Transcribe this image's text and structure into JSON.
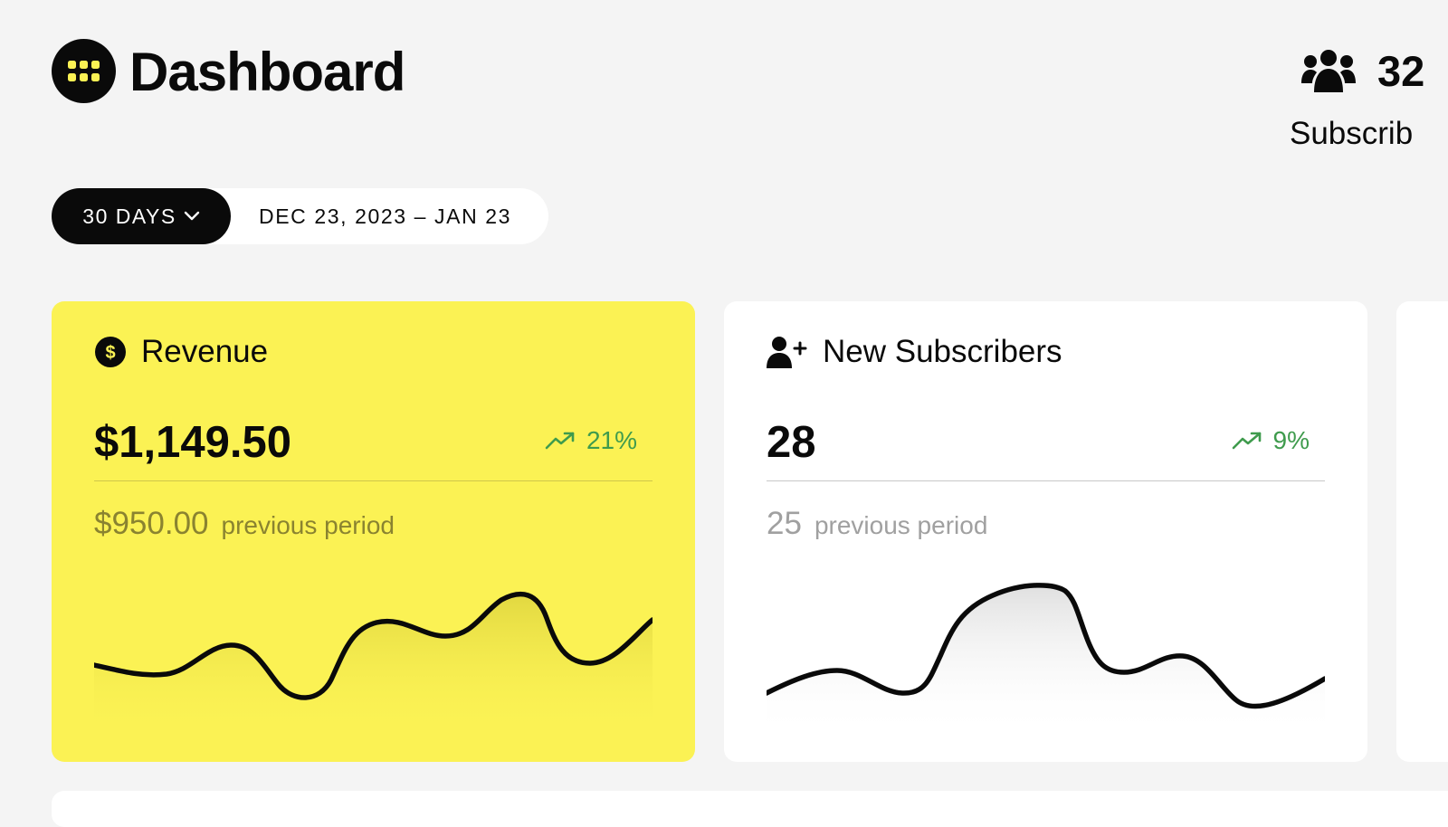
{
  "header": {
    "title": "Dashboard",
    "logo_icon": "grid-dots-icon"
  },
  "subscribers_summary": {
    "icon": "users-icon",
    "count": "32",
    "label": "Subscrib"
  },
  "period": {
    "range_label": "30 DAYS",
    "dates": "DEC 23, 2023 – JAN 23"
  },
  "cards": {
    "revenue": {
      "icon": "dollar-circle-icon",
      "title": "Revenue",
      "value": "$1,149.50",
      "trend": "21%",
      "previous_value": "$950.00",
      "previous_label": "previous period",
      "background": "#fbf254"
    },
    "new_subscribers": {
      "icon": "user-plus-icon",
      "title": "New Subscribers",
      "value": "28",
      "trend": "9%",
      "previous_value": "25",
      "previous_label": "previous period",
      "background": "#ffffff"
    }
  },
  "colors": {
    "accent_yellow": "#fbf254",
    "trend_green": "#3f9b4d",
    "text_dark": "#0a0a0a"
  }
}
